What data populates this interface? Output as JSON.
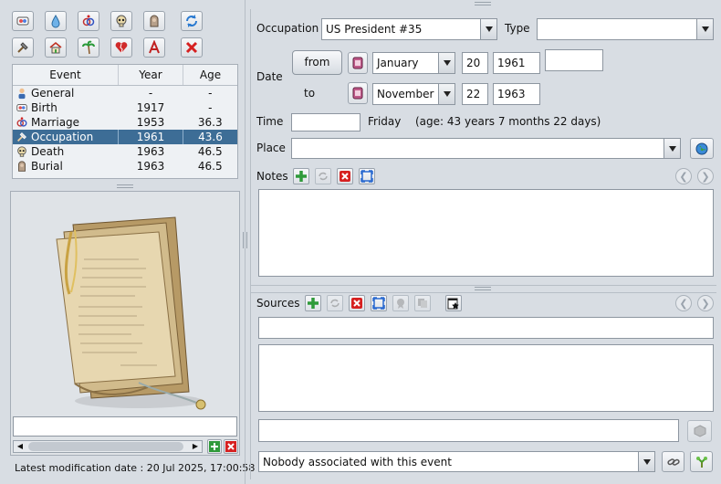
{
  "toolbar": {
    "row1_icons": [
      "birth-icon",
      "baptism-icon",
      "marriage-icon",
      "death-icon",
      "burial-icon",
      "refresh-icon"
    ],
    "row2_icons": [
      "occupation-icon",
      "residence-icon",
      "travel-icon",
      "divorce-icon",
      "event-icon",
      "delete-icon"
    ]
  },
  "events_table": {
    "headers": {
      "event": "Event",
      "year": "Year",
      "age": "Age"
    },
    "rows": [
      {
        "icon": "general-icon",
        "event": "General",
        "year": "-",
        "age": "-"
      },
      {
        "icon": "birth-icon",
        "event": "Birth",
        "year": "1917",
        "age": "-"
      },
      {
        "icon": "marriage-icon",
        "event": "Marriage",
        "year": "1953",
        "age": "36.3"
      },
      {
        "icon": "occupation-icon",
        "event": "Occupation",
        "year": "1961",
        "age": "43.6",
        "selected": true
      },
      {
        "icon": "death-icon",
        "event": "Death",
        "year": "1963",
        "age": "46.5"
      },
      {
        "icon": "burial-icon",
        "event": "Burial",
        "year": "1963",
        "age": "46.5"
      }
    ]
  },
  "image_caption_value": "",
  "status": {
    "modification": "Latest modification date : 20 Jul 2025, 17:00:58"
  },
  "form": {
    "occupation_label": "Occupation",
    "occupation_value": "US President #35",
    "type_label": "Type",
    "type_value": "",
    "date_label": "Date",
    "from_button": "from",
    "to_label": "to",
    "from_month": "January",
    "from_day": "20",
    "from_year": "1961",
    "from_extra": "",
    "to_month": "November",
    "to_day": "22",
    "to_year": "1963",
    "time_label": "Time",
    "time_value": "",
    "weekday": "Friday",
    "age_text": "(age: 43 years 7 months 22 days)",
    "place_label": "Place",
    "place_value": "",
    "notes_label": "Notes",
    "notes_value": ""
  },
  "sources": {
    "label": "Sources",
    "title_value": "",
    "text_value": "",
    "bottom_value": ""
  },
  "associations": {
    "value": "Nobody associated with this event"
  }
}
